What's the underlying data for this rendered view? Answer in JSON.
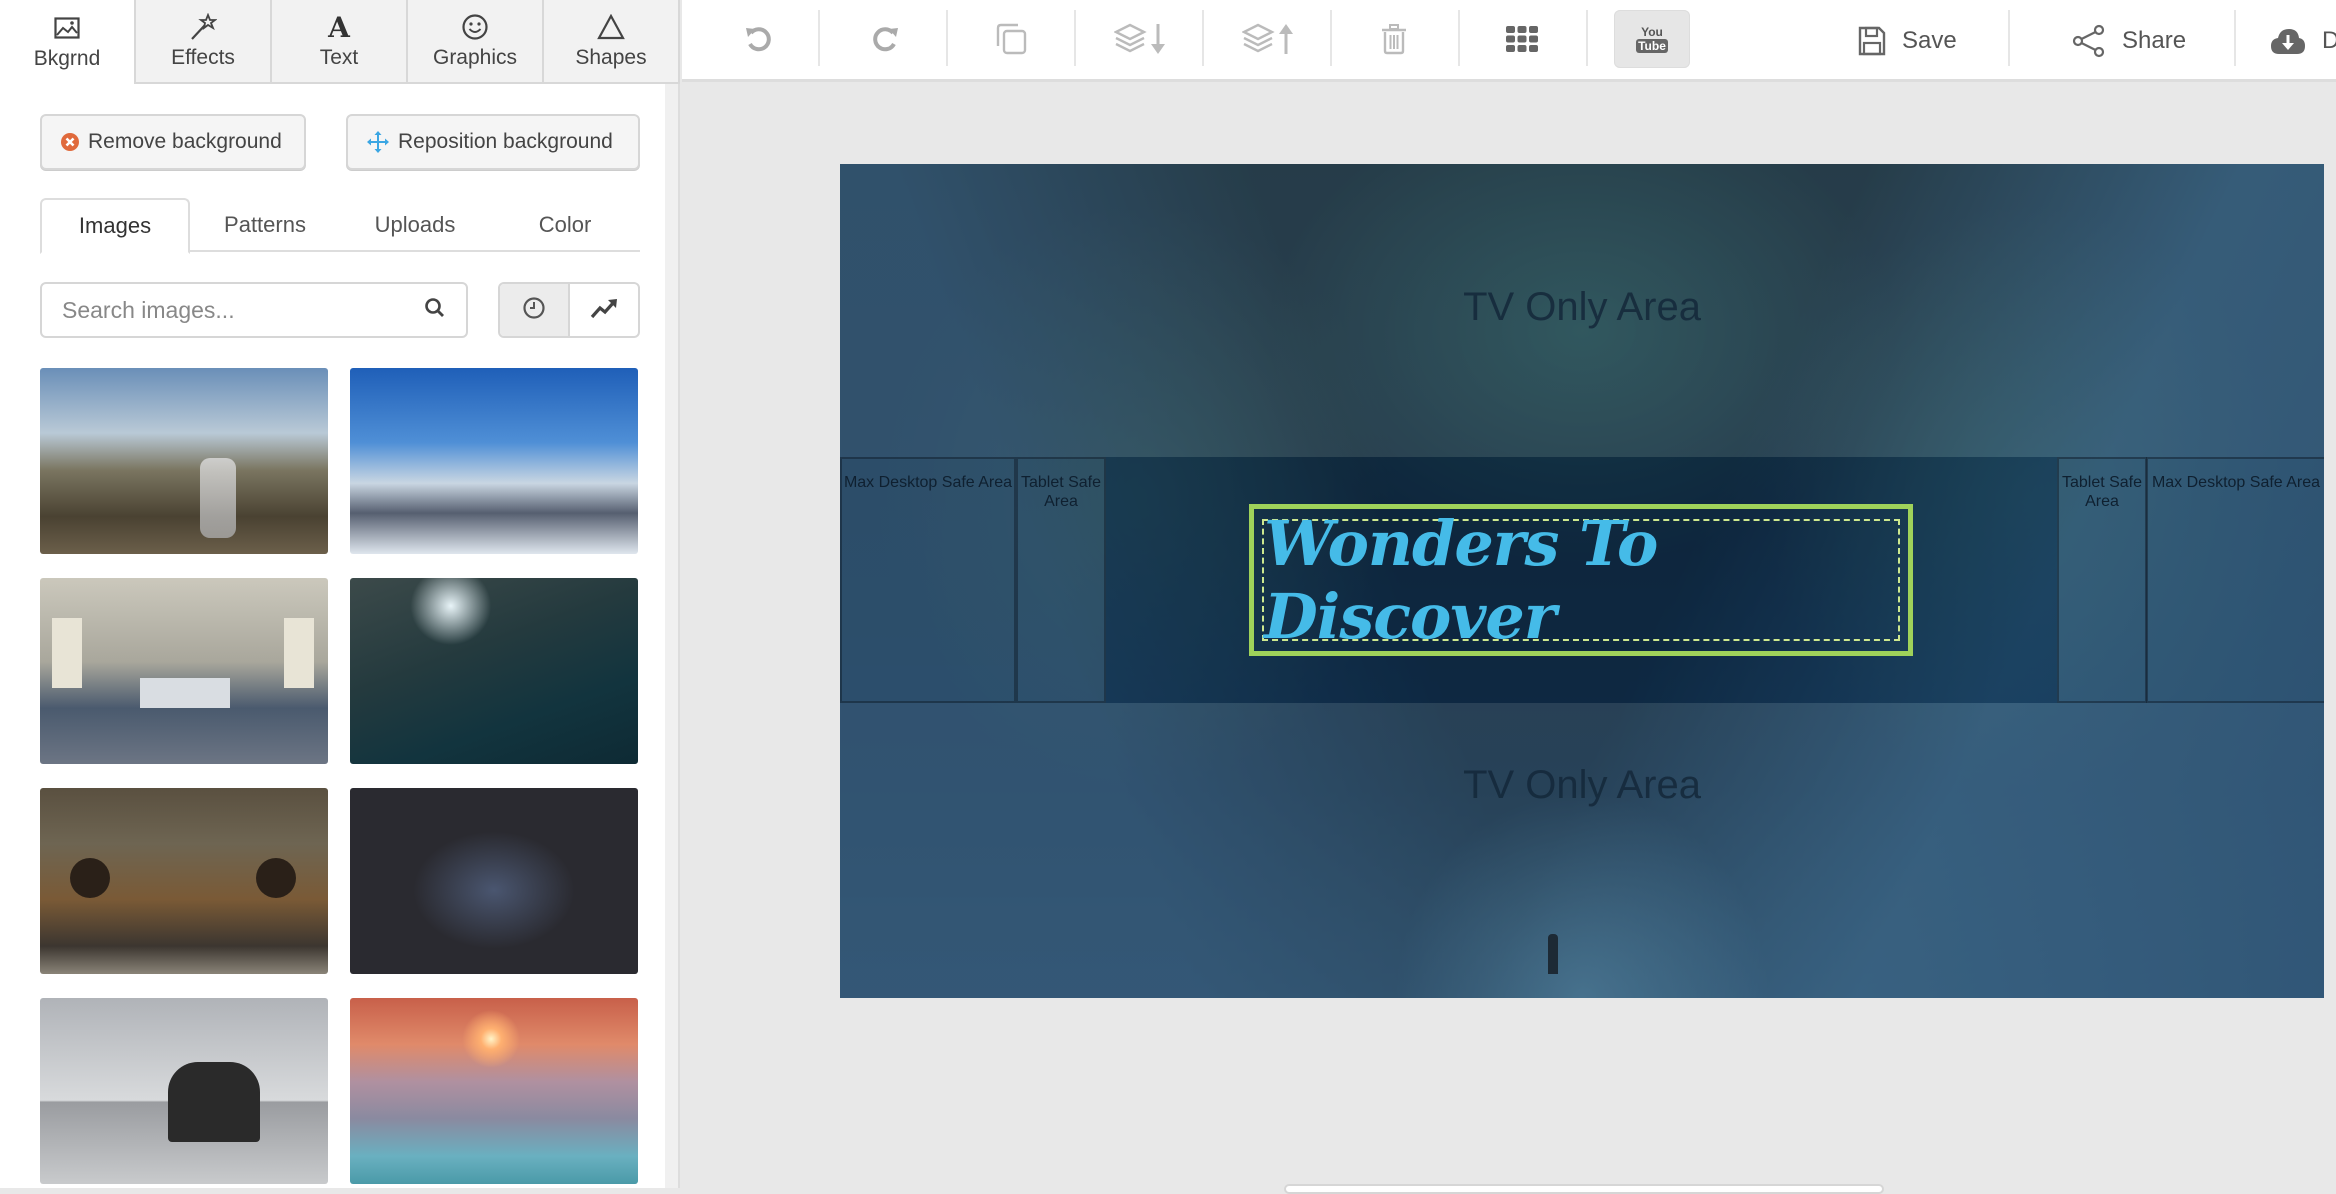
{
  "sidebar": {
    "tabs": [
      {
        "label": "Bkgrnd",
        "icon": "image-icon",
        "active": true
      },
      {
        "label": "Effects",
        "icon": "magic-wand-icon"
      },
      {
        "label": "Text",
        "icon": "text-icon"
      },
      {
        "label": "Graphics",
        "icon": "smiley-icon"
      },
      {
        "label": "Shapes",
        "icon": "triangle-icon"
      }
    ],
    "remove_background": "Remove background",
    "reposition_background": "Reposition background",
    "subtabs": [
      {
        "label": "Images",
        "active": true
      },
      {
        "label": "Patterns"
      },
      {
        "label": "Uploads"
      },
      {
        "label": "Color"
      }
    ],
    "search": {
      "placeholder": "Search images...",
      "value": ""
    },
    "sort_options": [
      {
        "name": "recent",
        "icon": "clock-icon",
        "active": true
      },
      {
        "name": "trending",
        "icon": "trending-icon"
      }
    ],
    "thumbnails": [
      {
        "subject": "waterfall rocky hill"
      },
      {
        "subject": "snowy mountain peaks"
      },
      {
        "subject": "abandoned hospital room"
      },
      {
        "subject": "cave light beam"
      },
      {
        "subject": "rusty old van"
      },
      {
        "subject": "jumping spider macro"
      },
      {
        "subject": "sea rock arch"
      },
      {
        "subject": "ice at sunset"
      }
    ]
  },
  "toolbar": {
    "icons": [
      "undo-icon",
      "redo-icon",
      "duplicate-icon",
      "send-backward-icon",
      "bring-forward-icon",
      "delete-icon",
      "grid-icon",
      "youtube-icon"
    ],
    "youtube_top": "You",
    "youtube_bottom": "Tube",
    "save_label": "Save",
    "share_label": "Share",
    "download_label": "D"
  },
  "canvas": {
    "tv_top_label": "TV Only Area",
    "tv_bottom_label": "TV Only Area",
    "max_desktop_left": "Max Desktop Safe Area",
    "tablet_left": "Tablet Safe Area",
    "tablet_right": "Tablet Safe Area",
    "max_desktop_right": "Max Desktop Safe Area",
    "headline": "Wonders To Discover",
    "colors": {
      "headline": "#45bbe8",
      "frame": "#9fd25a"
    }
  }
}
